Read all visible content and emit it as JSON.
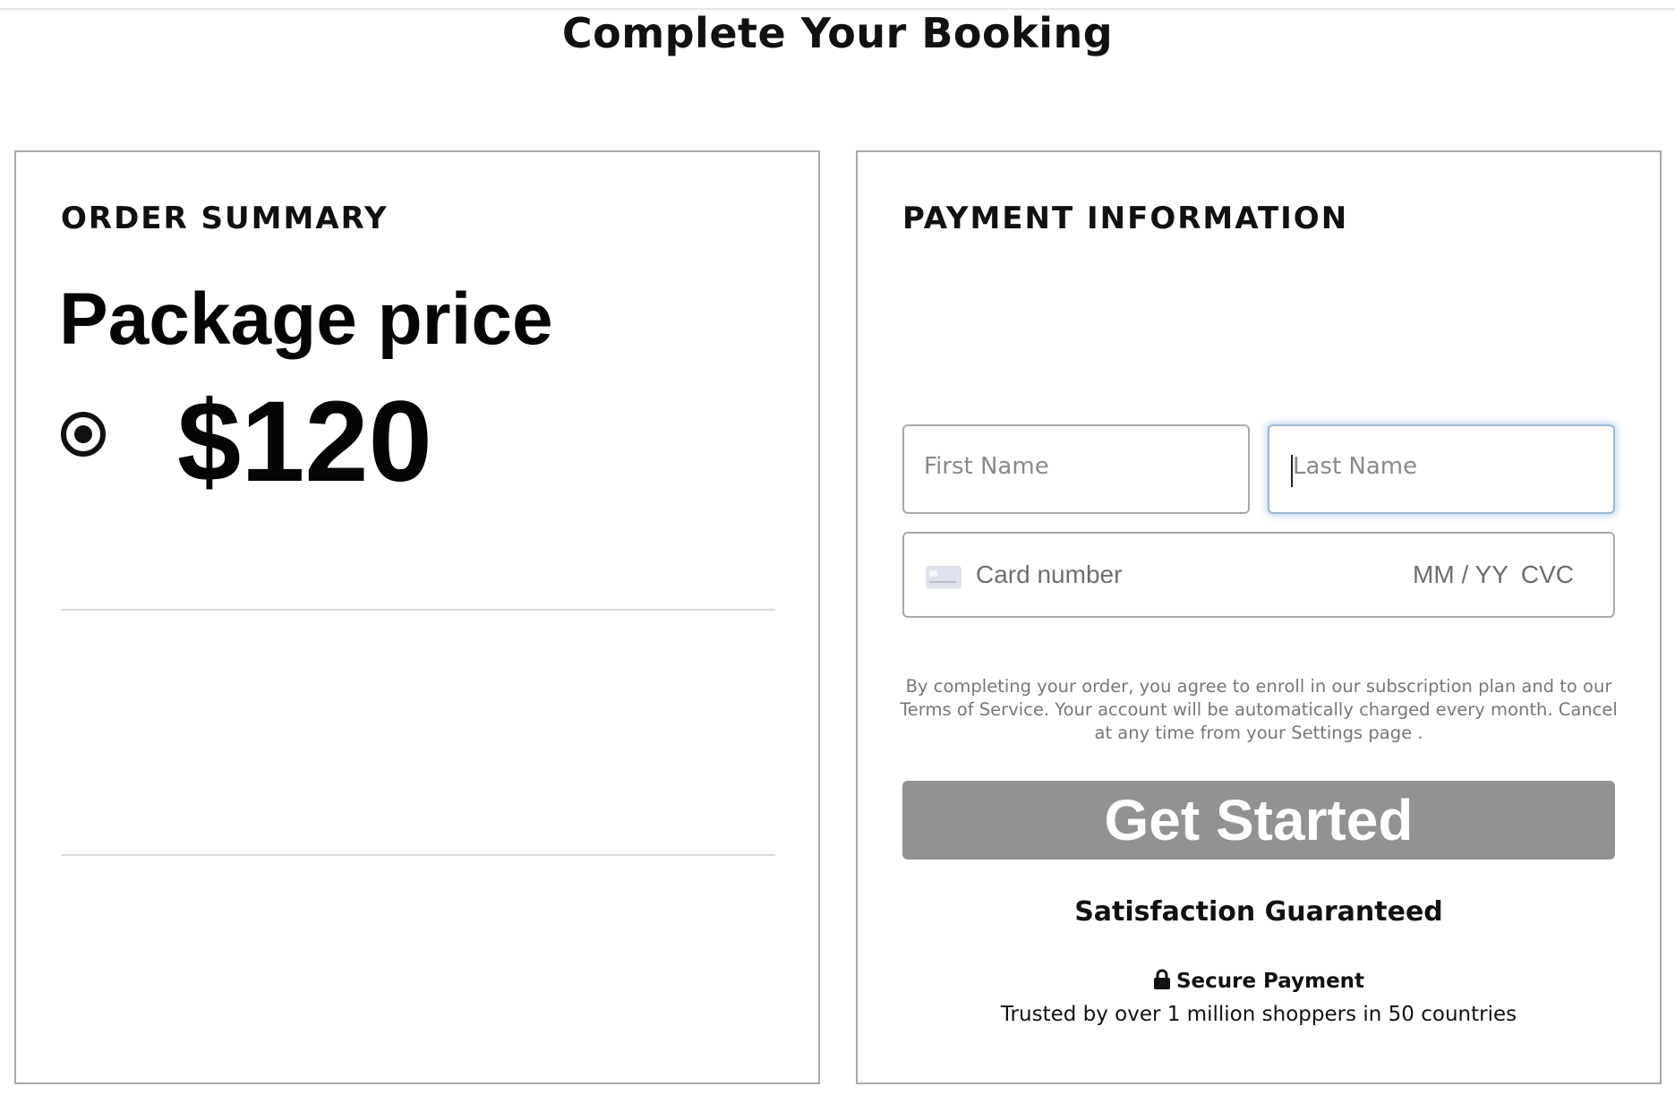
{
  "page": {
    "title": "Complete Your Booking"
  },
  "order_summary": {
    "title": "ORDER SUMMARY",
    "package_label": "Package price",
    "price": "$120",
    "option_selected": true
  },
  "payment": {
    "title": "PAYMENT INFORMATION",
    "first_name": {
      "placeholder": "First Name",
      "value": ""
    },
    "last_name": {
      "placeholder": "Last Name",
      "value": "",
      "focused": true
    },
    "card": {
      "number_placeholder": "Card number",
      "expiry_placeholder": "MM / YY",
      "cvc_placeholder": "CVC",
      "icon": "credit-card-icon"
    },
    "terms": "By completing your order, you agree to enroll in our subscription plan and to our Terms of Service. Your account will be automatically charged every month. Cancel at any time from your Settings page .",
    "cta_label": "Get Started",
    "cta_color": "#929292",
    "guarantee": "Satisfaction Guaranteed",
    "secure_label": "Secure Payment",
    "secure_icon": "lock-icon",
    "trusted": "Trusted by over 1 million shoppers in 50 countries"
  }
}
